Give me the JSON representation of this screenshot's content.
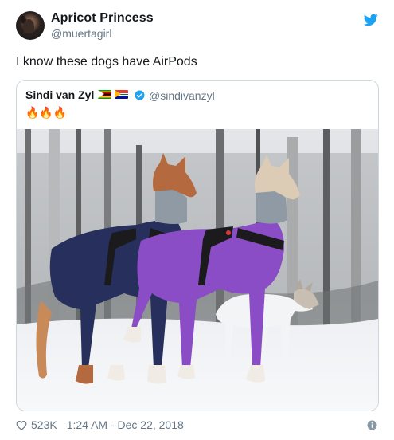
{
  "tweet": {
    "display_name": "Apricot Princess",
    "handle": "@muertagirl",
    "text": "I know these dogs have AirPods"
  },
  "quoted_tweet": {
    "display_name": "Sindi van Zyl",
    "flags": [
      "zimbabwe-flag",
      "south-africa-flag"
    ],
    "verified": true,
    "handle": "@sindivanzyl",
    "text": "🔥🔥🔥"
  },
  "footer": {
    "likes": "523K",
    "timestamp": "1:24 AM - Dec 22, 2018"
  },
  "colors": {
    "brand_blue": "#1da1f2",
    "secondary_text": "#657786",
    "border": "#ccd6dd"
  }
}
